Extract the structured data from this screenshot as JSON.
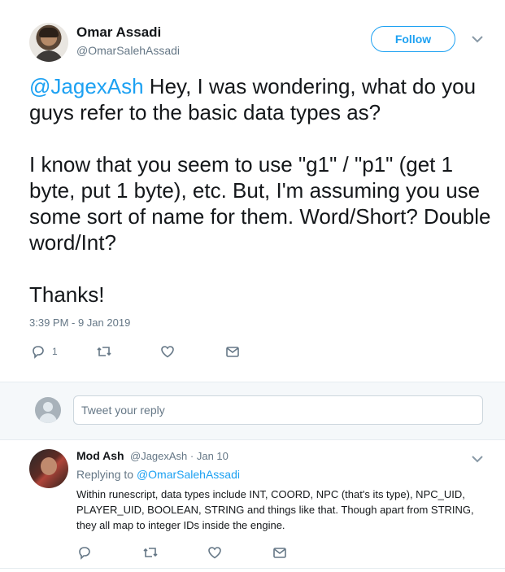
{
  "tweet": {
    "author_name": "Omar Assadi",
    "author_handle": "@OmarSalehAssadi",
    "follow_label": "Follow",
    "mention": "@JagexAsh",
    "body": " Hey, I was wondering, what do you guys refer to the basic data types as?\n\nI know that you seem to use \"g1\" / \"p1\" (get 1 byte, put 1 byte), etc. But, I'm assuming you use some sort of name for them. Word/Short? Double word/Int?\n\nThanks!",
    "timestamp": "3:39 PM - 9 Jan 2019",
    "reply_count": "1",
    "icons": {
      "reply": "reply-icon",
      "retweet": "retweet-icon",
      "like": "heart-icon",
      "dm": "envelope-icon",
      "more": "chevron-down-icon"
    }
  },
  "reply_box": {
    "placeholder": "Tweet your reply"
  },
  "reply_tweet": {
    "author_name": "Mod Ash",
    "meta": "@JagexAsh · Jan 10",
    "replying_prefix": "Replying to ",
    "replying_to": "@OmarSalehAssadi",
    "body": "Within runescript, data types include INT, COORD, NPC (that's its type), NPC_UID, PLAYER_UID, BOOLEAN, STRING and things like that. Though apart from STRING, they all map to integer IDs inside the engine."
  },
  "colors": {
    "accent": "#1da1f2",
    "secondary_text": "#657786",
    "divider": "#e6ecf0"
  }
}
